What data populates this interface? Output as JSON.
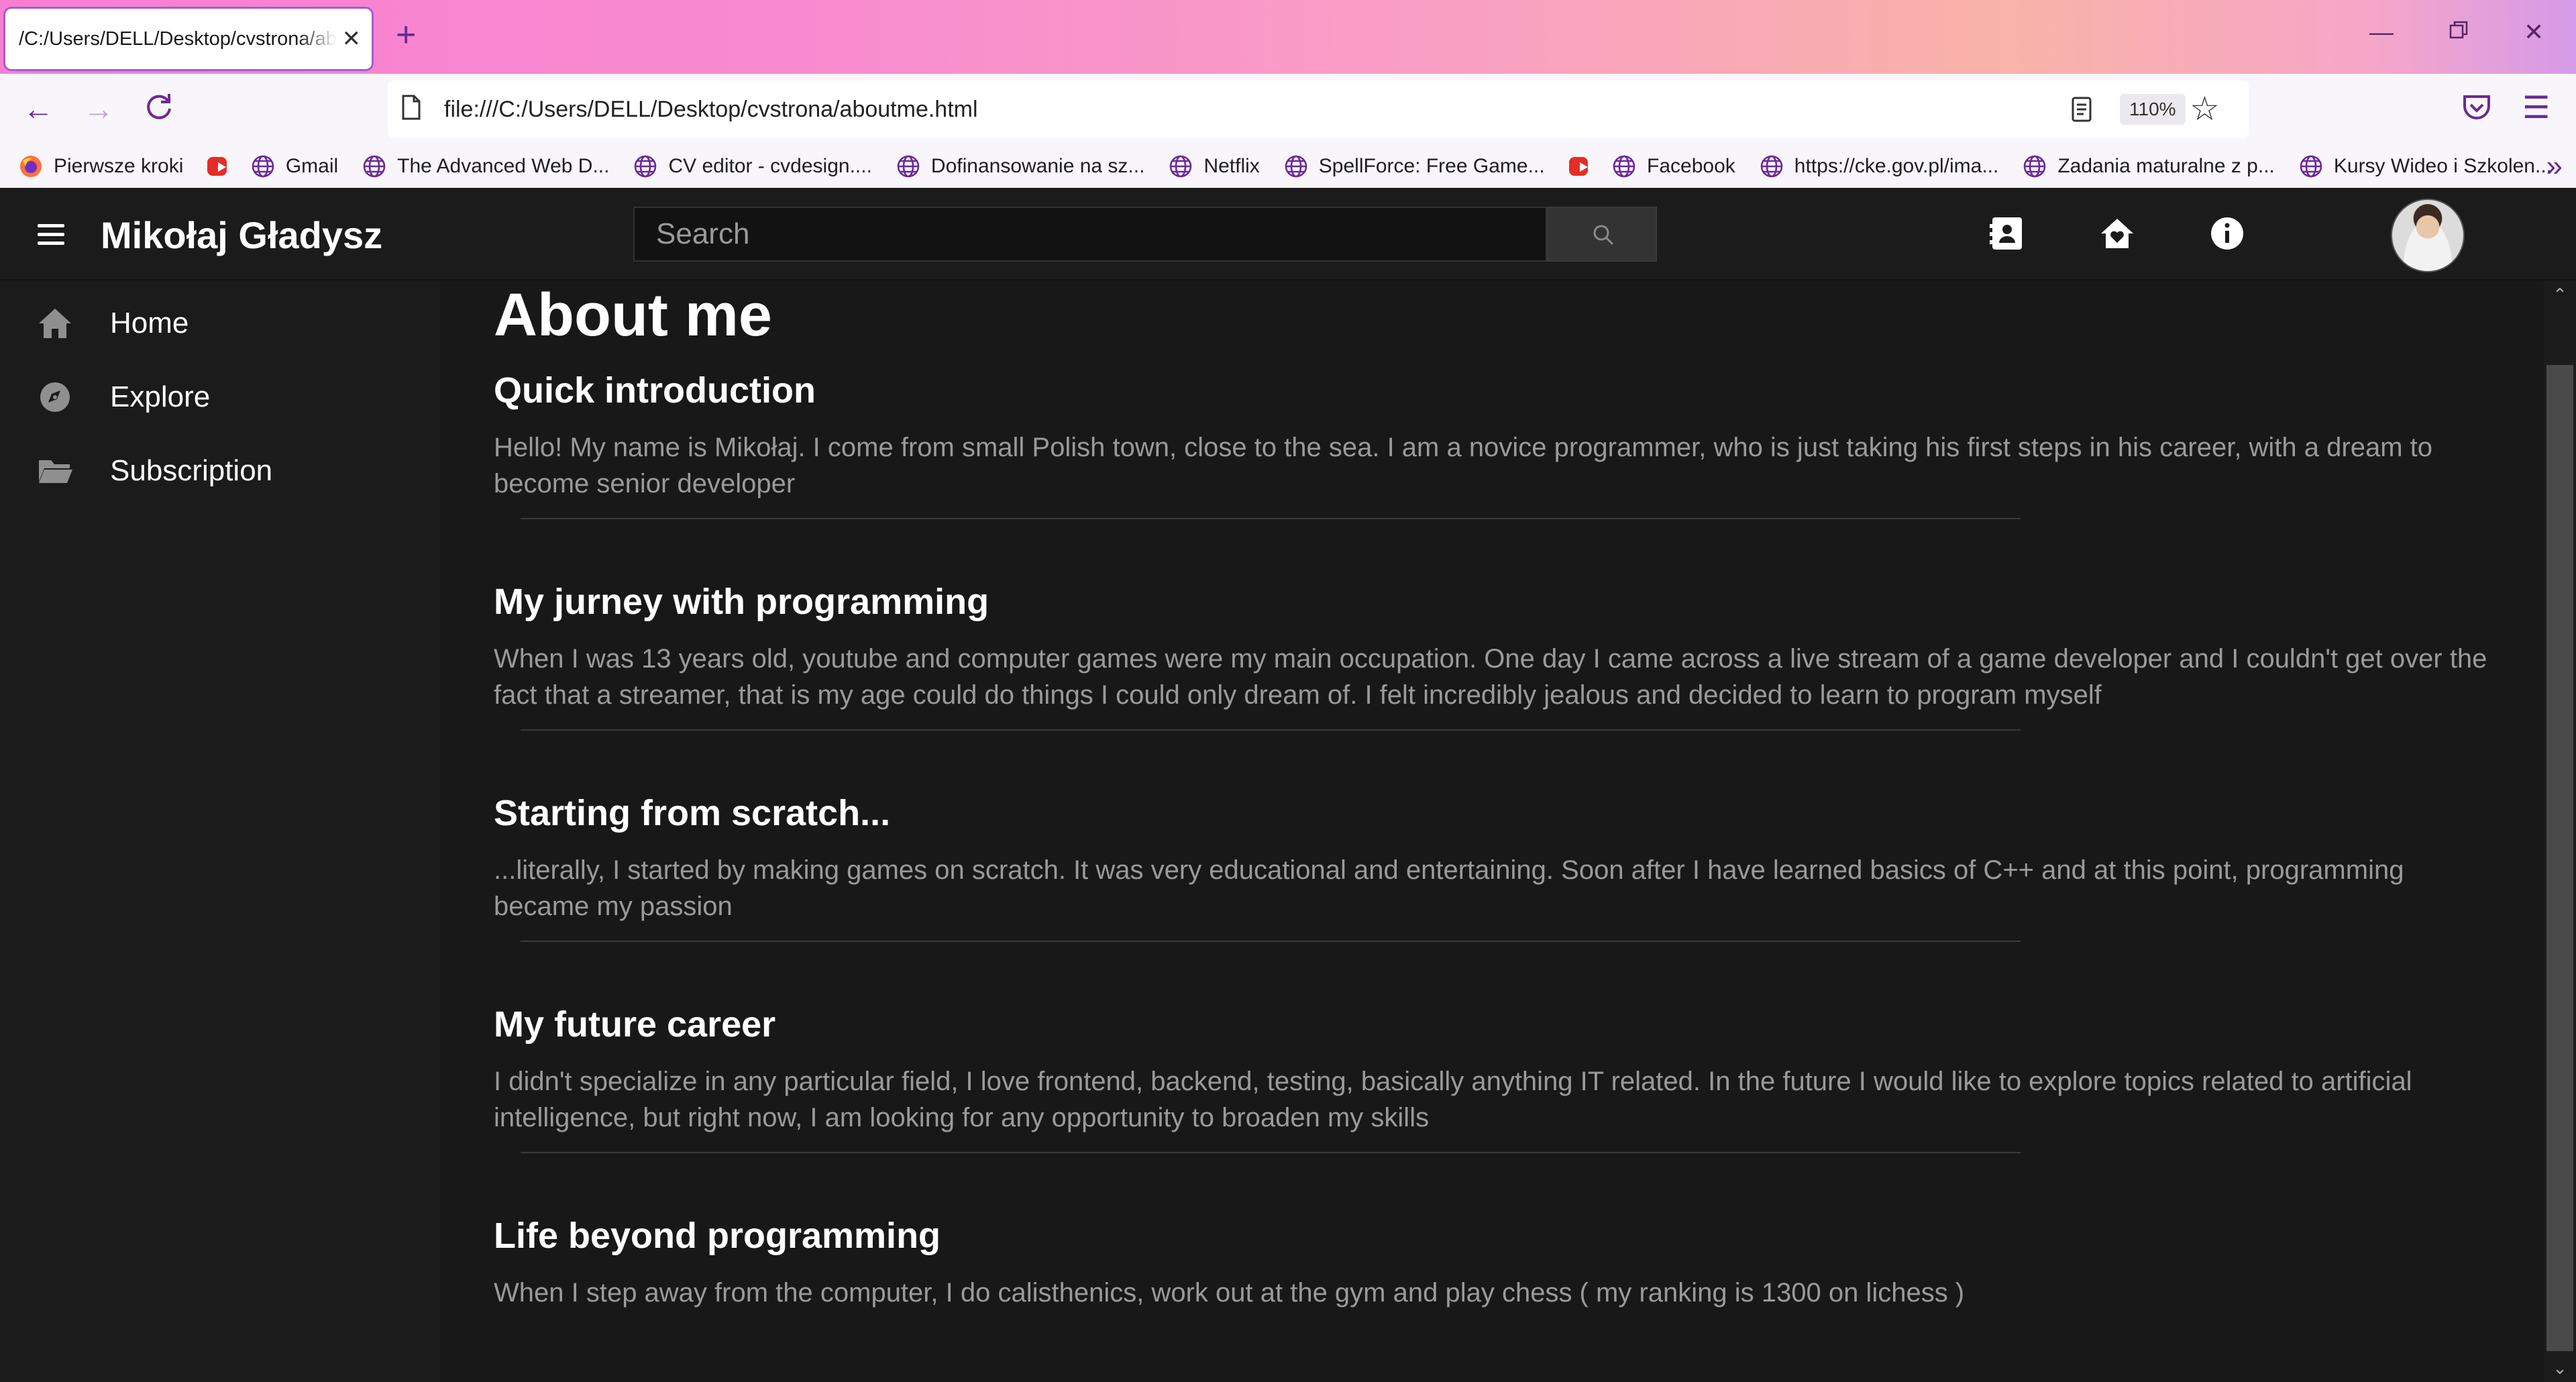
{
  "browser": {
    "tab_title": "/C:/Users/DELL/Desktop/cvstrona/aboutme.html",
    "tab_close": "✕",
    "new_tab": "+",
    "url": "file:///C:/Users/DELL/Desktop/cvstrona/aboutme.html",
    "zoom": "110%",
    "bookmarks": [
      {
        "label": "Pierwsze kroki",
        "icon": "firefox-icon"
      },
      {
        "label": "",
        "icon": "youtube-icon"
      },
      {
        "label": "Gmail",
        "icon": "globe-icon"
      },
      {
        "label": "The Advanced Web D...",
        "icon": "globe-icon"
      },
      {
        "label": "CV editor - cvdesign....",
        "icon": "globe-icon"
      },
      {
        "label": "Dofinansowanie na sz...",
        "icon": "globe-icon"
      },
      {
        "label": "Netflix",
        "icon": "globe-icon"
      },
      {
        "label": "SpellForce: Free Game...",
        "icon": "globe-icon"
      },
      {
        "label": "",
        "icon": "youtube-icon"
      },
      {
        "label": "Facebook",
        "icon": "globe-icon"
      },
      {
        "label": "https://cke.gov.pl/ima...",
        "icon": "globe-icon"
      },
      {
        "label": "Zadania maturalne z p...",
        "icon": "globe-icon"
      },
      {
        "label": "Kursy Wideo i Szkolen...",
        "icon": "globe-icon"
      }
    ],
    "accent": "#6b2a95"
  },
  "site": {
    "title": "Mikołaj Gładysz",
    "search_placeholder": "Search",
    "sidebar": [
      {
        "label": "Home",
        "icon": "home-icon"
      },
      {
        "label": "Explore",
        "icon": "compass-icon"
      },
      {
        "label": "Subscription",
        "icon": "folder-icon"
      }
    ]
  },
  "content": {
    "heading": "About me",
    "sections": [
      {
        "title": "Quick introduction",
        "body": "Hello! My name is Mikołaj. I come from small Polish town, close to the sea. I am a novice programmer, who is just taking his first steps in his career, with a dream to become senior developer"
      },
      {
        "title": "My jurney with programming",
        "body": "When I was 13 years old, youtube and computer games were my main occupation. One day I came across a live stream of a game developer and I couldn't get over the fact that a streamer, that is my age could do things I could only dream of. I felt incredibly jealous and decided to learn to program myself"
      },
      {
        "title": "Starting from scratch...",
        "body": "...literally, I started by making games on scratch. It was very educational and entertaining. Soon after I have learned basics of C++ and at this point, programming became my passion"
      },
      {
        "title": "My future career",
        "body": "I didn't specialize in any particular field, I love frontend, backend, testing, basically anything IT related. In the future I would like to explore topics related to artificial intelligence, but right now, I am looking for any opportunity to broaden my skills"
      },
      {
        "title": "Life beyond programming",
        "body": "When I step away from the computer, I do calisthenics, work out at the gym and play chess ( my ranking is 1300 on lichess )"
      }
    ]
  }
}
